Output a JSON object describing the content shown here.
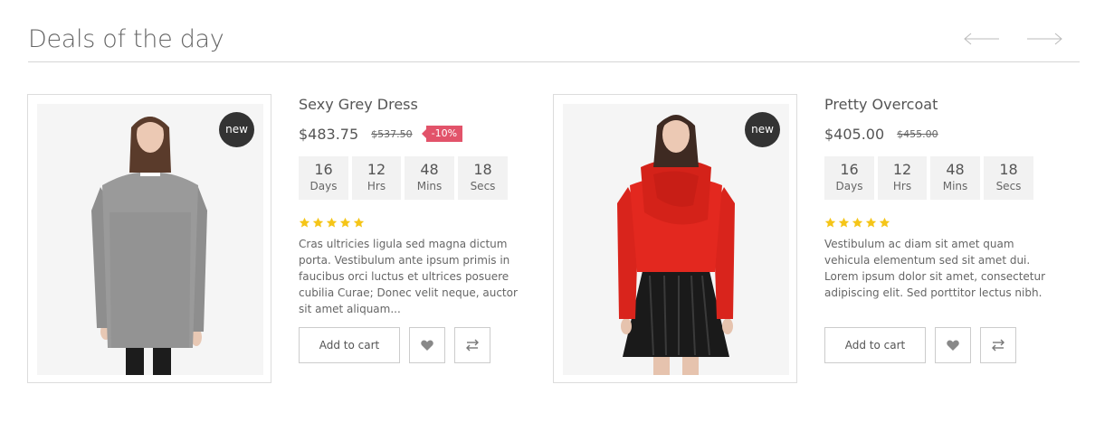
{
  "section": {
    "title": "Deals of the day"
  },
  "icons": {
    "prev": "arrow-left-icon",
    "next": "arrow-right-icon",
    "wishlist": "heart-icon",
    "compare": "compare-arrows-icon",
    "rating": "star-icon"
  },
  "colors": {
    "discount_badge": "#e2536a",
    "new_badge": "#333333",
    "star": "#f5c518",
    "countdown_bg": "#f2f2f2"
  },
  "products": [
    {
      "name": "Sexy Grey Dress",
      "badge": "new",
      "price": "$483.75",
      "old_price": "$537.50",
      "discount": "-10%",
      "countdown": {
        "days": "16",
        "days_label": "Days",
        "hours": "12",
        "hours_label": "Hrs",
        "mins": "48",
        "mins_label": "Mins",
        "secs": "18",
        "secs_label": "Secs"
      },
      "rating": 5,
      "description": "Cras ultricies ligula sed magna dictum porta. Vestibulum ante ipsum primis in faucibus orci luctus et ultrices posuere cubilia Curae; Donec velit neque, auctor sit amet aliquam...",
      "add_to_cart": "Add to cart"
    },
    {
      "name": "Pretty Overcoat",
      "badge": "new",
      "price": "$405.00",
      "old_price": "$455.00",
      "discount": "",
      "countdown": {
        "days": "16",
        "days_label": "Days",
        "hours": "12",
        "hours_label": "Hrs",
        "mins": "48",
        "mins_label": "Mins",
        "secs": "18",
        "secs_label": "Secs"
      },
      "rating": 5,
      "description": "Vestibulum ac diam sit amet quam vehicula elementum sed sit amet dui. Lorem ipsum dolor sit amet, consectetur adipiscing elit. Sed porttitor lectus nibh.",
      "add_to_cart": "Add to cart"
    }
  ]
}
